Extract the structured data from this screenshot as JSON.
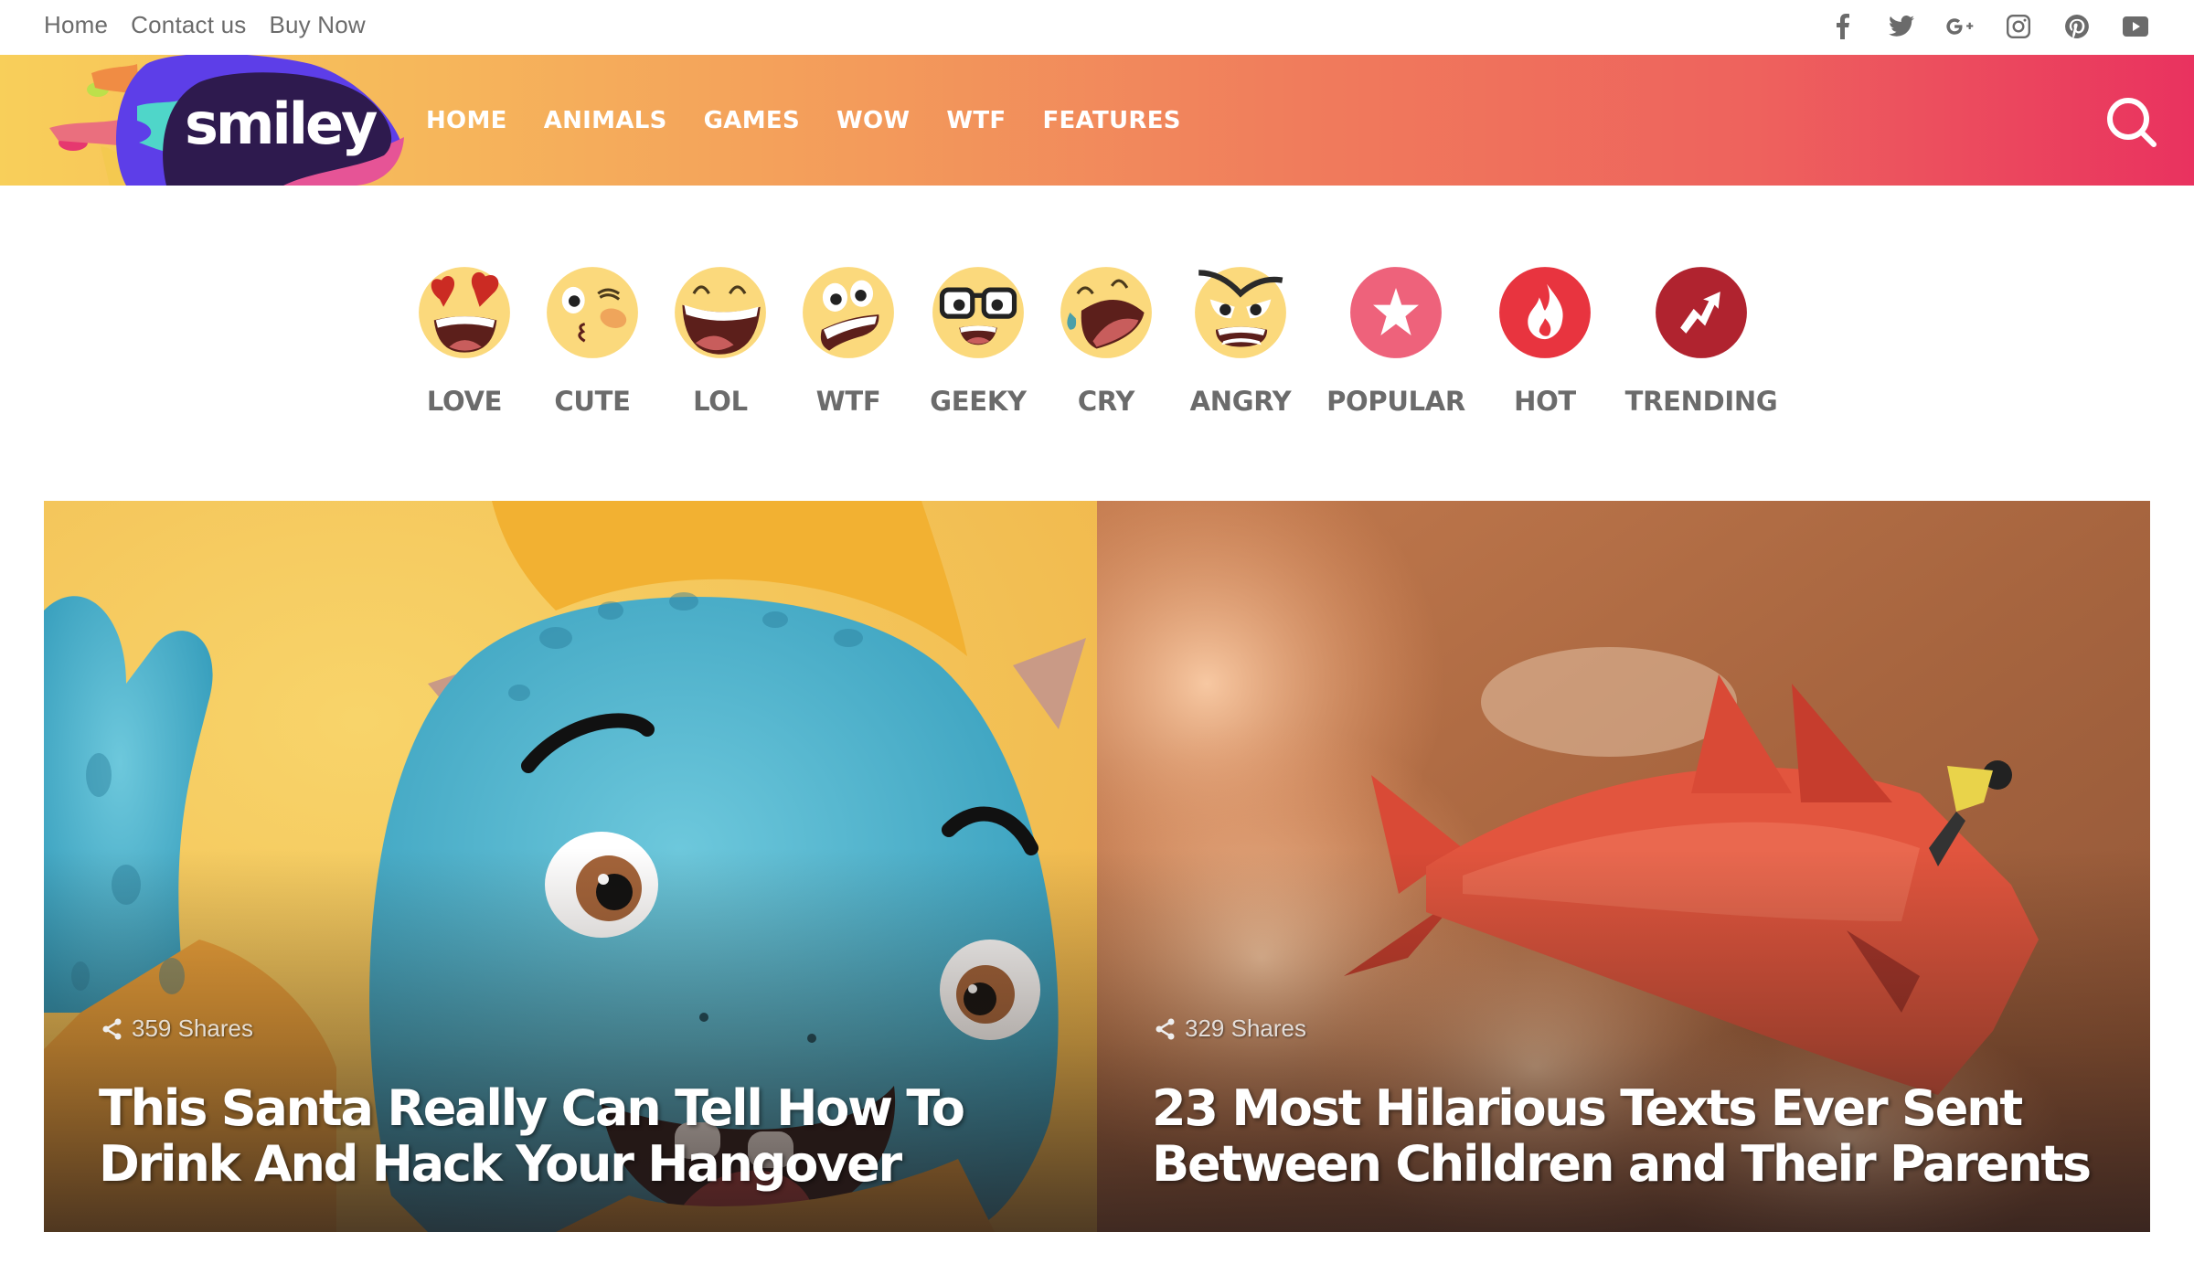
{
  "top_links": [
    "Home",
    "Contact us",
    "Buy Now"
  ],
  "social_icons": [
    "facebook-icon",
    "twitter-icon",
    "google-plus-icon",
    "instagram-icon",
    "pinterest-icon",
    "youtube-icon"
  ],
  "header": {
    "logo_text": "smiley",
    "nav": [
      "HOME",
      "ANIMALS",
      "GAMES",
      "WOW",
      "WTF",
      "FEATURES"
    ],
    "search_icon": "search-icon",
    "gradient_colors": [
      "#f8cf5a",
      "#f39a5b",
      "#e9325f"
    ]
  },
  "reactions": [
    {
      "label": "LOVE",
      "icon": "love-emoji-icon"
    },
    {
      "label": "CUTE",
      "icon": "cute-emoji-icon"
    },
    {
      "label": "LOL",
      "icon": "lol-emoji-icon"
    },
    {
      "label": "WTF",
      "icon": "wtf-emoji-icon"
    },
    {
      "label": "GEEKY",
      "icon": "geeky-emoji-icon"
    },
    {
      "label": "CRY",
      "icon": "cry-emoji-icon"
    },
    {
      "label": "ANGRY",
      "icon": "angry-emoji-icon"
    },
    {
      "label": "POPULAR",
      "icon": "star-icon",
      "color": "#ee627b"
    },
    {
      "label": "HOT",
      "icon": "flame-icon",
      "color": "#e8343f"
    },
    {
      "label": "TRENDING",
      "icon": "trending-arrow-icon",
      "color": "#b0232f"
    }
  ],
  "cards": [
    {
      "shares": "359 Shares",
      "title": "This Santa Really Can Tell How To Drink And Hack Your Hangover",
      "image": "blue cartoon monster waving on yellow background"
    },
    {
      "shares": "329 Shares",
      "title": "23 Most Hilarious Texts Ever Sent Between Children and Their Parents",
      "image": "person riding a red paper fish through orange clouds"
    }
  ]
}
